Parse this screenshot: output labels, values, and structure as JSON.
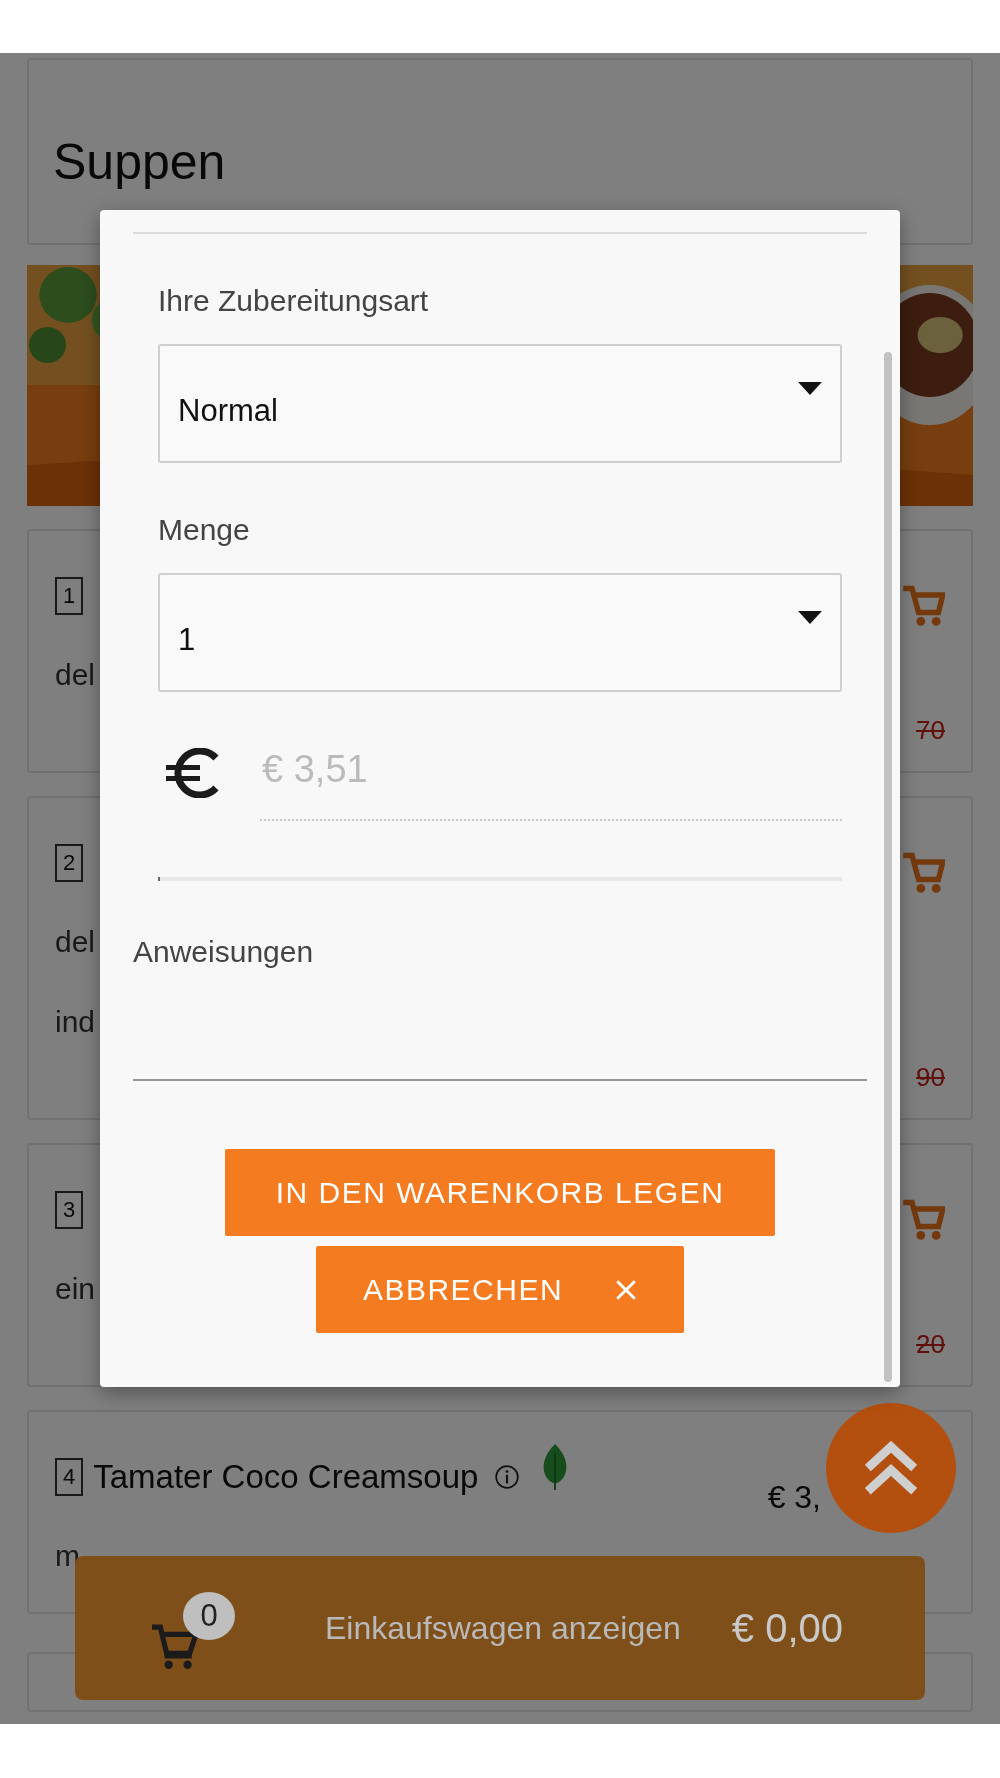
{
  "section_title": "Suppen",
  "items": [
    {
      "number": "1",
      "description_lines": [
        "del"
      ],
      "old_price": "70"
    },
    {
      "number": "2",
      "description_lines": [
        "del",
        "ind"
      ],
      "old_price": "90"
    },
    {
      "number": "3",
      "description_lines": [
        "ein"
      ],
      "old_price": "20"
    },
    {
      "number": "4",
      "name": "Tamater Coco Creamsoup",
      "price": "€ 3,",
      "description_lines": [
        "m"
      ]
    }
  ],
  "dialog": {
    "preparation": {
      "label": "Ihre Zubereitungsart",
      "value": "Normal"
    },
    "quantity": {
      "label": "Menge",
      "value": "1"
    },
    "price_field": {
      "value": "€ 3,51",
      "disabled": true
    },
    "instructions": {
      "label": "Anweisungen"
    },
    "buttons": [
      {
        "kind": "add",
        "label": "IN DEN WARENKORB LEGEN"
      },
      {
        "kind": "cancel",
        "label": "ABBRECHEN"
      }
    ]
  },
  "cart_bar": {
    "count": "0",
    "label": "Einkaufswagen anzeigen",
    "total": "€ 0,00"
  }
}
